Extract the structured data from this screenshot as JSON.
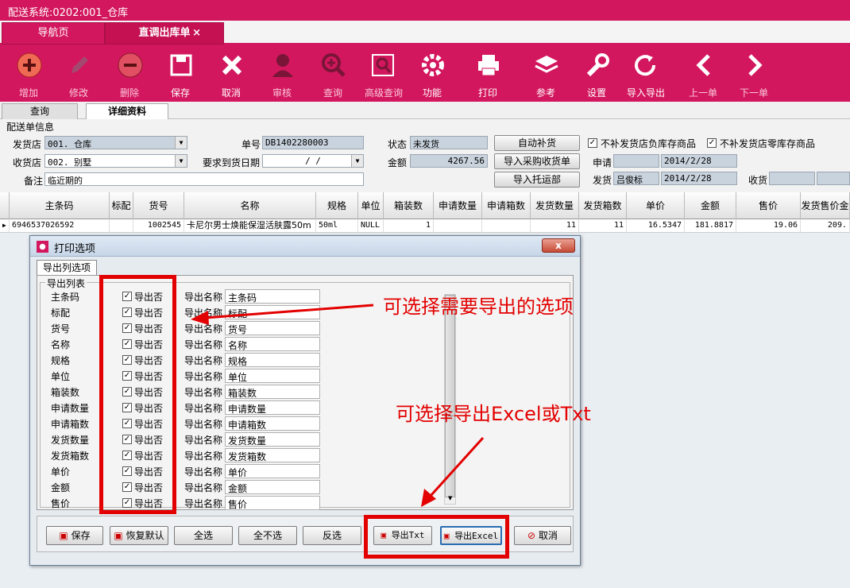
{
  "window": {
    "title": "配送系统:0202:001_仓库"
  },
  "tabs": [
    {
      "label": "导航页"
    },
    {
      "label": "直调出库单",
      "close": "×"
    }
  ],
  "toolbar": [
    {
      "label": "增加",
      "icon": "add-icon"
    },
    {
      "label": "修改",
      "icon": "pencil-icon"
    },
    {
      "label": "删除",
      "icon": "minus-icon"
    },
    {
      "label": "保存",
      "icon": "floppy-icon"
    },
    {
      "label": "取消",
      "icon": "x-icon"
    },
    {
      "label": "审核",
      "icon": "user-icon"
    },
    {
      "label": "查询",
      "icon": "zoom-icon"
    },
    {
      "label": "高级查询",
      "icon": "advanced-search-icon"
    },
    {
      "label": "功能",
      "icon": "gear-icon"
    },
    {
      "label": "打印",
      "icon": "printer-icon"
    },
    {
      "label": "参考",
      "icon": "layers-icon"
    },
    {
      "label": "设置",
      "icon": "wrench-icon"
    },
    {
      "label": "导入导出",
      "icon": "refresh-icon"
    },
    {
      "label": "上一单",
      "icon": "chevron-left-icon"
    },
    {
      "label": "下一单",
      "icon": "chevron-right-icon"
    }
  ],
  "subtabs": [
    "查询",
    "详细资料"
  ],
  "form": {
    "section": "配送单信息",
    "sender_label": "发货店",
    "sender_value": "001. 仓库",
    "receiver_label": "收货店",
    "receiver_value": "002. 别墅",
    "note_label": "备注",
    "note_value": "临近期的",
    "order_no_label": "单号",
    "order_no_value": "DB1402280003",
    "required_date_label": "要求到货日期",
    "required_date_value": "/  /",
    "status_label": "状态",
    "status_value": "未发货",
    "amount_label": "金额",
    "amount_value": "4267.56",
    "btn_auto": "自动补货",
    "btn_import_purchase": "导入采购收货单",
    "btn_import_consign": "导入托运部",
    "chk1": "不补发货店负库存商品",
    "chk2": "不补发货店零库存商品",
    "apply_label": "申请",
    "apply_date": "2014/2/28",
    "ship_label": "发货",
    "ship_person": "吕俊标",
    "ship_date": "2014/2/28",
    "receive_label": "收货"
  },
  "grid": {
    "headers": [
      "主条码",
      "标配",
      "货号",
      "名称",
      "规格",
      "单位",
      "箱装数",
      "申请数量",
      "申请箱数",
      "发货数量",
      "发货箱数",
      "单价",
      "金额",
      "售价",
      "发货售价金"
    ],
    "row": [
      "6946537026592",
      "",
      "1002545",
      "卡尼尔男士焕能保湿活肤露50m",
      "50ml",
      "NULL",
      "1",
      "",
      "",
      "11",
      "11",
      "16.5347",
      "181.8817",
      "19.06",
      "209."
    ]
  },
  "dialog": {
    "title": "打印选项",
    "close": "x",
    "tab": "导出列选项",
    "group": "导出列表",
    "export_label": "导出否",
    "name_label": "导出名称",
    "fields": [
      {
        "field": "主条码",
        "name": "主条码"
      },
      {
        "field": "标配",
        "name": "标配"
      },
      {
        "field": "货号",
        "name": "货号"
      },
      {
        "field": "名称",
        "name": "名称"
      },
      {
        "field": "规格",
        "name": "规格"
      },
      {
        "field": "单位",
        "name": "单位"
      },
      {
        "field": "箱装数",
        "name": "箱装数"
      },
      {
        "field": "申请数量",
        "name": "申请数量"
      },
      {
        "field": "申请箱数",
        "name": "申请箱数"
      },
      {
        "field": "发货数量",
        "name": "发货数量"
      },
      {
        "field": "发货箱数",
        "name": "发货箱数"
      },
      {
        "field": "单价",
        "name": "单价"
      },
      {
        "field": "金额",
        "name": "金额"
      },
      {
        "field": "售价",
        "name": "售价"
      }
    ],
    "buttons": {
      "save": "保存",
      "restore": "恢复默认",
      "select_all": "全选",
      "select_none": "全不选",
      "invert": "反选",
      "export_txt": "导出Txt",
      "export_excel": "导出Excel",
      "cancel": "取消"
    }
  },
  "annotations": {
    "a1": "可选择需要导出的选项",
    "a2": "可选择导出Excel或Txt"
  },
  "colors": {
    "brand": "#d3175e",
    "annotation": "#e30000"
  }
}
